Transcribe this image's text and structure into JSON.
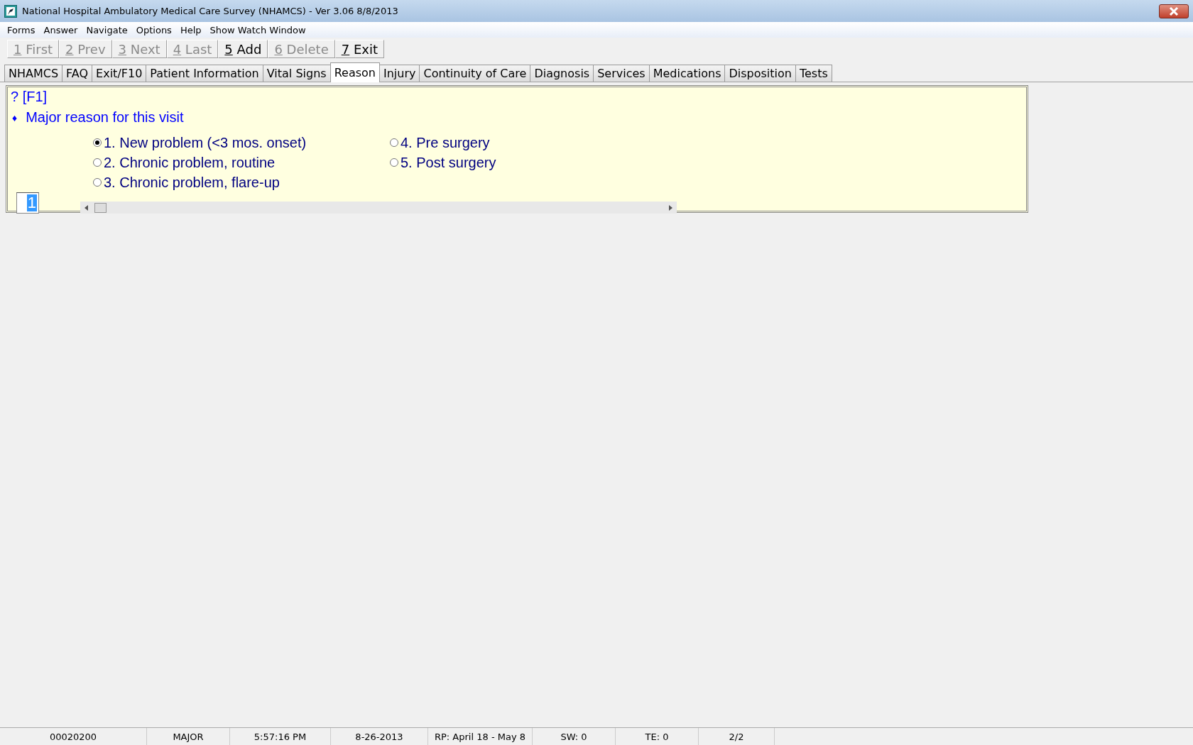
{
  "window": {
    "title": "National Hospital Ambulatory Medical Care Survey (NHAMCS) - Ver 3.06 8/8/2013"
  },
  "menu": [
    "Forms",
    "Answer",
    "Navigate",
    "Options",
    "Help",
    "Show Watch Window"
  ],
  "toolbar": [
    {
      "key": "1",
      "label": "First",
      "disabled": true
    },
    {
      "key": "2",
      "label": "Prev",
      "disabled": true
    },
    {
      "key": "3",
      "label": "Next",
      "disabled": true
    },
    {
      "key": "4",
      "label": "Last",
      "disabled": true
    },
    {
      "key": "5",
      "label": "Add",
      "disabled": false
    },
    {
      "key": "6",
      "label": "Delete",
      "disabled": true
    },
    {
      "key": "7",
      "label": "Exit",
      "disabled": false
    }
  ],
  "tabs": [
    {
      "label": "NHAMCS",
      "selected": false
    },
    {
      "label": "FAQ",
      "selected": false
    },
    {
      "label": "Exit/F10",
      "selected": false
    },
    {
      "label": "Patient Information",
      "selected": false
    },
    {
      "label": "Vital Signs",
      "selected": false
    },
    {
      "label": "Reason",
      "selected": true
    },
    {
      "label": "Injury",
      "selected": false
    },
    {
      "label": "Continuity of Care",
      "selected": false
    },
    {
      "label": "Diagnosis",
      "selected": false
    },
    {
      "label": "Services",
      "selected": false
    },
    {
      "label": "Medications",
      "selected": false
    },
    {
      "label": "Disposition",
      "selected": false
    },
    {
      "label": "Tests",
      "selected": false
    }
  ],
  "question": {
    "help": "? [F1]",
    "bullet": "♦",
    "text": "Major reason for this visit",
    "options": [
      {
        "label": "1. New problem (<3 mos. onset)",
        "selected": true
      },
      {
        "label": "2. Chronic problem, routine",
        "selected": false
      },
      {
        "label": "3. Chronic problem, flare-up",
        "selected": false
      },
      {
        "label": "4. Pre surgery",
        "selected": false
      },
      {
        "label": "5. Post surgery",
        "selected": false
      }
    ],
    "answer": "1"
  },
  "status_bar": [
    "00020200",
    "MAJOR",
    "5:57:16 PM",
    "8-26-2013",
    "RP: April 18  -  May 8",
    "SW: 0",
    "TE: 0",
    "2/2"
  ]
}
